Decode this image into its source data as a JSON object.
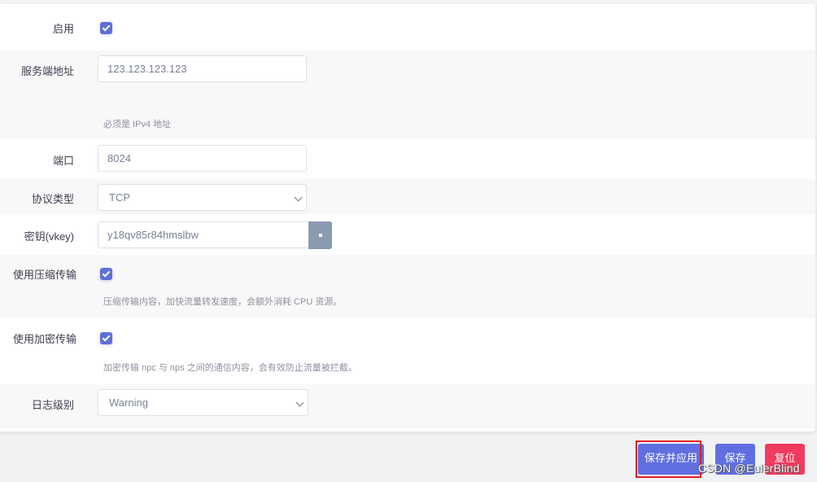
{
  "form": {
    "enable": {
      "label": "启用",
      "checked": true
    },
    "server_address": {
      "label": "服务端地址",
      "value": "123.123.123.123",
      "help": "必须是 IPv4 地址"
    },
    "port": {
      "label": "端口",
      "value": "8024"
    },
    "protocol": {
      "label": "协议类型",
      "selected": "TCP"
    },
    "vkey": {
      "label": "密钥(vkey)",
      "value": "y18qv85r84hmslbw"
    },
    "compress": {
      "label": "使用压缩传输",
      "checked": true,
      "help": "压缩传输内容，加快流量转发速度，会额外消耗 CPU 资源。"
    },
    "crypt": {
      "label": "使用加密传输",
      "checked": true,
      "help": "加密传输 npc 与 nps 之间的通信内容，会有效防止流量被拦截。"
    },
    "log_level": {
      "label": "日志级别",
      "selected": "Warning"
    }
  },
  "actions": {
    "save_apply": "保存并应用",
    "save": "保存",
    "reset": "复位"
  },
  "colors": {
    "primary": "#5f6fe0",
    "danger": "#f03a5f",
    "annotation": "#e01e23"
  },
  "watermark": "CSDN @EulerBlind"
}
